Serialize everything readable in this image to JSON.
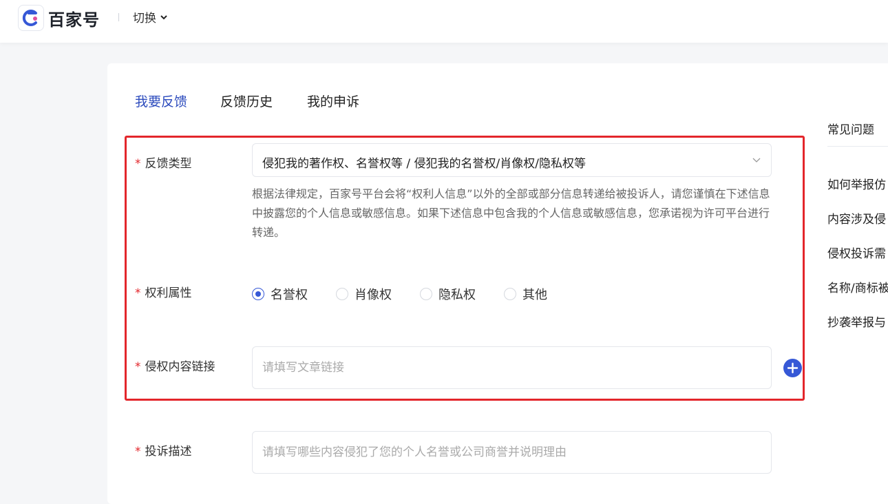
{
  "header": {
    "brand": "百家号",
    "switch_label": "切换"
  },
  "tabs": [
    {
      "label": "我要反馈",
      "active": true
    },
    {
      "label": "反馈历史",
      "active": false
    },
    {
      "label": "我的申诉",
      "active": false
    }
  ],
  "form": {
    "required_mark": "*",
    "feedback_type": {
      "label": "反馈类型",
      "value": "侵犯我的著作权、名誉权等 / 侵犯我的名誉权/肖像权/隐私权等"
    },
    "notice": "根据法律规定，百家号平台会将“权利人信息”以外的全部或部分信息转递给被投诉人，请您谨慎在下述信息中披露您的个人信息或敏感信息。如果下述信息中包含我的个人信息或敏感信息，您承诺视为许可平台进行转递。",
    "rights": {
      "label": "权利属性",
      "options": [
        "名誉权",
        "肖像权",
        "隐私权",
        "其他"
      ],
      "selected": "名誉权"
    },
    "link": {
      "label": "侵权内容链接",
      "value": "",
      "placeholder": "请填写文章链接"
    },
    "description": {
      "label": "投诉描述",
      "value": "",
      "placeholder": "请填写哪些内容侵犯了您的个人名誉或公司商誉并说明理由"
    }
  },
  "faq": {
    "title": "常见问题",
    "items": [
      "如何举报仿",
      "内容涉及侵",
      "侵权投诉需",
      "名称/商标被",
      "抄袭举报与"
    ]
  },
  "colors": {
    "accent": "#3658d6",
    "tab_active": "#2c4bbd",
    "highlight_border": "#e3262b",
    "required": "#e3262b"
  }
}
